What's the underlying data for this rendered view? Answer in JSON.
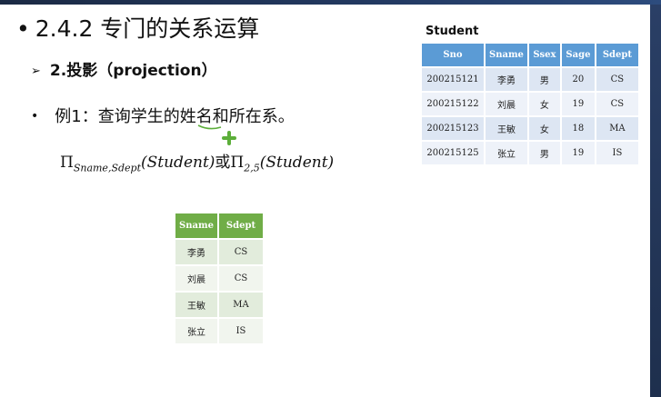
{
  "title": "2.4.2 专门的关系运算",
  "subtitle": "2.投影（projection）",
  "example": "例1：查询学生的姓名和所在系。",
  "formula": {
    "part1_sub": "Sname,Sdept",
    "part1_arg": "(Student)",
    "connector": "或",
    "part2_sub": "2,5",
    "part2_arg": "(Student)"
  },
  "student_table": {
    "caption": "Student",
    "headers": [
      "Sno",
      "Sname",
      "Ssex",
      "Sage",
      "Sdept"
    ],
    "rows": [
      [
        "200215121",
        "李勇",
        "男",
        "20",
        "CS"
      ],
      [
        "200215122",
        "刘晨",
        "女",
        "19",
        "CS"
      ],
      [
        "200215123",
        "王敏",
        "女",
        "18",
        "MA"
      ],
      [
        "200215125",
        "张立",
        "男",
        "19",
        "IS"
      ]
    ]
  },
  "projection_table": {
    "headers": [
      "Sname",
      "Sdept"
    ],
    "rows": [
      [
        "李勇",
        "CS"
      ],
      [
        "刘晨",
        "CS"
      ],
      [
        "王敏",
        "MA"
      ],
      [
        "张立",
        "IS"
      ]
    ]
  },
  "colors": {
    "student_header": "#5b9bd5",
    "projection_header": "#70ad47",
    "annotation": "#5cae3a"
  }
}
